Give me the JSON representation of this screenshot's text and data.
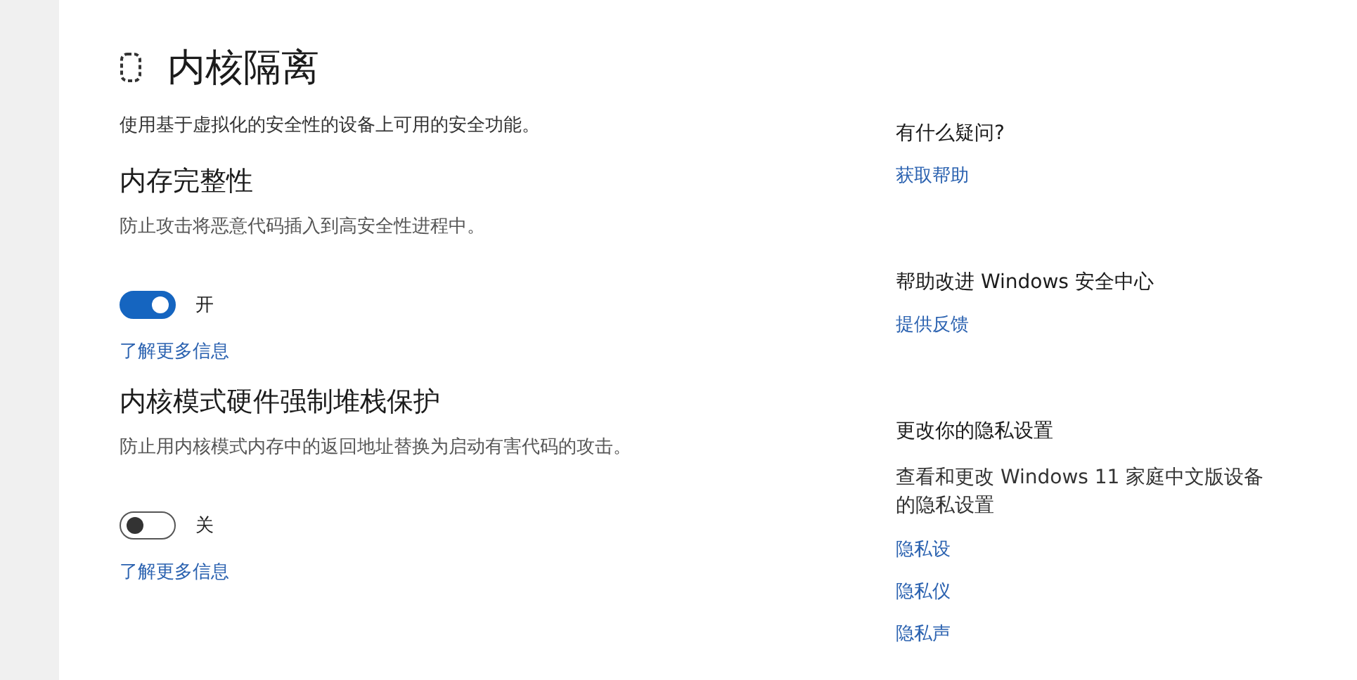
{
  "page": {
    "title": "内核隔离",
    "description": "使用基于虚拟化的安全性的设备上可用的安全功能。"
  },
  "sections": [
    {
      "heading": "内存完整性",
      "description": "防止攻击将恶意代码插入到高安全性进程中。",
      "on": true,
      "state_label": "开",
      "link": "了解更多信息"
    },
    {
      "heading": "内核模式硬件强制堆栈保护",
      "description": "防止用内核模式内存中的返回地址替换为启动有害代码的攻击。",
      "on": false,
      "state_label": "关",
      "link": "了解更多信息"
    }
  ],
  "sidebar": [
    {
      "heading": "有什么疑问?",
      "links": [
        "获取帮助"
      ]
    },
    {
      "heading": "帮助改进 Windows 安全中心",
      "links": [
        "提供反馈"
      ]
    },
    {
      "heading": "更改你的隐私设置",
      "text": "查看和更改 Windows 11 家庭中文版设备的隐私设置",
      "links": [
        "隐私设",
        "隐私仪",
        "隐私声"
      ]
    }
  ]
}
